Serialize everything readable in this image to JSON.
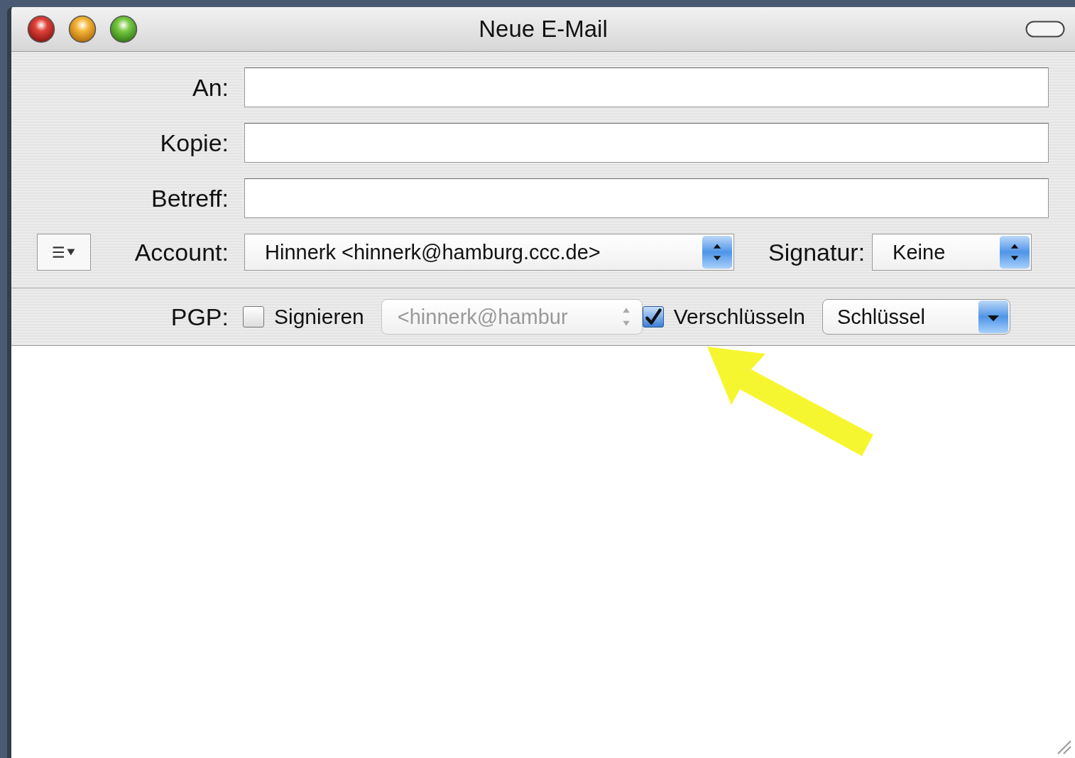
{
  "window": {
    "title": "Neue E-Mail"
  },
  "fields": [
    {
      "label": "An:"
    },
    {
      "label": "Kopie:"
    },
    {
      "label": "Betreff:"
    }
  ],
  "account": {
    "label": "Account:",
    "value": "Hinnerk <hinnerk@hamburg.ccc.de>"
  },
  "signature": {
    "label": "Signatur:",
    "value": "Keine"
  },
  "pgp": {
    "label": "PGP:",
    "sign": {
      "label": "Signieren",
      "checked": false
    },
    "sign_key": {
      "value": "<hinnerk@hambur",
      "disabled": true
    },
    "encrypt": {
      "label": "Verschlüsseln",
      "checked": true
    },
    "encrypt_key": {
      "value": "Schlüssel",
      "disabled": false
    }
  },
  "annotation": {
    "kind": "arrow"
  }
}
